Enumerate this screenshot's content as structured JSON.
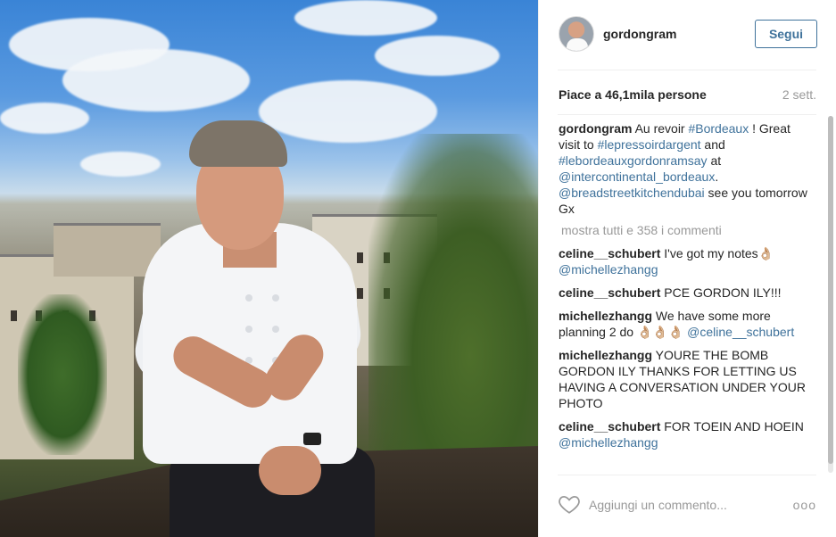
{
  "post": {
    "username": "gordongram",
    "follow_label": "Segui",
    "likes": "Piace a 46,1mila persone",
    "time": "2 sett.",
    "caption": {
      "user": "gordongram",
      "t1": " Au revoir ",
      "tag1": "#Bordeaux",
      "t2": " ! Great visit to ",
      "tag2": "#lepressoirdargent",
      "t3": " and ",
      "tag3": "#lebordeauxgordonramsay",
      "t4": " at ",
      "mention1": "@intercontinental_bordeaux",
      "t5": ". ",
      "mention2": "@breadstreetkitchendubai",
      "t6": " see you tomorrow Gx"
    },
    "view_all": "mostra tutti e 358 i commenti",
    "comments": [
      {
        "user": "celine__schubert",
        "text": " I've got my notes👌🏼 ",
        "mention": "@michellezhangg"
      },
      {
        "user": "celine__schubert",
        "text": " PCE GORDON ILY!!!",
        "mention": ""
      },
      {
        "user": "michellezhangg",
        "text": " We have some more planning 2 do 👌🏼👌🏼👌🏼 ",
        "mention": "@celine__schubert"
      },
      {
        "user": "michellezhangg",
        "text": " YOURE THE BOMB GORDON ILY THANKS FOR LETTING US HAVING A CONVERSATION UNDER YOUR PHOTO",
        "mention": ""
      },
      {
        "user": "celine__schubert",
        "text": " FOR TOEIN AND HOEIN ",
        "mention": "@michellezhangg"
      }
    ],
    "add_comment_placeholder": "Aggiungi un commento...",
    "more_options": "ooo"
  },
  "icons": {
    "heart": "heart-outline-icon",
    "more": "more-options-icon"
  },
  "colors": {
    "link": "#3f729b",
    "muted": "#999999",
    "text": "#262626"
  }
}
